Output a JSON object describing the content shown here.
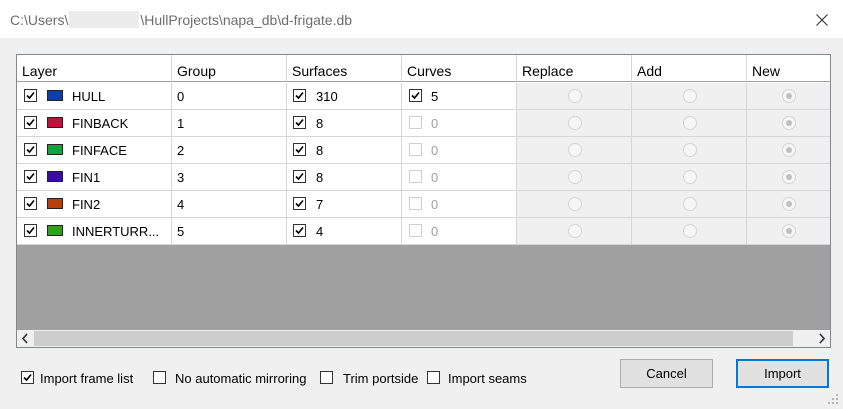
{
  "window": {
    "title_prefix": "C:\\Users\\",
    "title_suffix": "\\HullProjects\\napa_db\\d-frigate.db"
  },
  "grid": {
    "columns": [
      "Layer",
      "Group",
      "Surfaces",
      "Curves",
      "Replace",
      "Add",
      "New"
    ],
    "rows": [
      {
        "layer": "HULL",
        "color": "#0a3ea8",
        "group": "0",
        "surfaces": "310",
        "surfaces_checked": true,
        "curves": "5",
        "curves_enabled": true,
        "curves_checked": true
      },
      {
        "layer": "FINBACK",
        "color": "#b8163c",
        "group": "1",
        "surfaces": "8",
        "surfaces_checked": true,
        "curves": "0",
        "curves_enabled": false,
        "curves_checked": false
      },
      {
        "layer": "FINFACE",
        "color": "#12a33c",
        "group": "2",
        "surfaces": "8",
        "surfaces_checked": true,
        "curves": "0",
        "curves_enabled": false,
        "curves_checked": false
      },
      {
        "layer": "FIN1",
        "color": "#3a0aa8",
        "group": "3",
        "surfaces": "8",
        "surfaces_checked": true,
        "curves": "0",
        "curves_enabled": false,
        "curves_checked": false
      },
      {
        "layer": "FIN2",
        "color": "#b8400a",
        "group": "4",
        "surfaces": "7",
        "surfaces_checked": true,
        "curves": "0",
        "curves_enabled": false,
        "curves_checked": false
      },
      {
        "layer": "INNERTURR...",
        "color": "#2ea31a",
        "group": "5",
        "surfaces": "4",
        "surfaces_checked": true,
        "curves": "0",
        "curves_enabled": false,
        "curves_checked": false
      }
    ],
    "selected_action": "New"
  },
  "options": {
    "import_frame_list": {
      "label": "Import frame list",
      "checked": true
    },
    "no_auto_mirroring": {
      "label": "No automatic mirroring",
      "checked": false
    },
    "trim_portside": {
      "label": "Trim portside",
      "checked": false
    },
    "import_seams": {
      "label": "Import seams",
      "checked": false
    }
  },
  "buttons": {
    "cancel": "Cancel",
    "import": "Import"
  },
  "icons": {
    "close": "close-icon",
    "scroll_left": "chevron-left-icon",
    "scroll_right": "chevron-right-icon",
    "resize": "resize-grip-icon"
  }
}
